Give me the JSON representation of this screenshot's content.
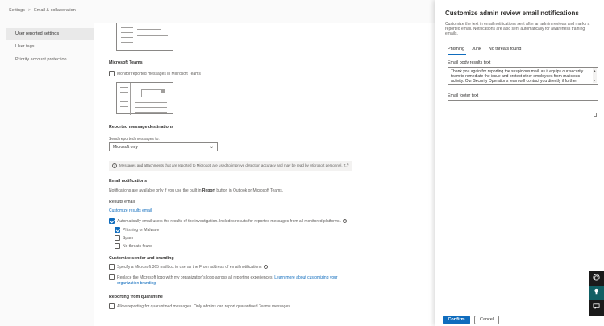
{
  "breadcrumb": {
    "root": "Settings",
    "separator": ">",
    "current": "Email & collaboration"
  },
  "leftnav": {
    "items": [
      {
        "label": "User reported settings"
      },
      {
        "label": "User tags"
      },
      {
        "label": "Priority account protection"
      }
    ]
  },
  "main": {
    "teams_section": {
      "title": "Microsoft Teams",
      "monitor_label": "Monitor reported messages in Microsoft Teams",
      "monitor_checked": false
    },
    "destinations": {
      "title": "Reported message destinations",
      "send_label": "Send reported messages to:",
      "selected": "Microsoft only",
      "info": "Messages and attachments that are reported to Microsoft are used to improve detection accuracy and may be read by Microsoft personnel. T..."
    },
    "email_notifications": {
      "title": "Email notifications",
      "desc_pre": "Notifications are available only if you use the built in ",
      "desc_bold": "Report",
      "desc_post": " button in Outlook or Microsoft Teams.",
      "results_title": "Results email",
      "customize_link": "Customize results email",
      "auto_label": "Automatically email users the results of the investigation. Includes results for reported messages from all monitored platforms.",
      "auto_checked": true,
      "options": [
        {
          "label": "Phishing or Malware",
          "checked": true
        },
        {
          "label": "Spam",
          "checked": false
        },
        {
          "label": "No threats found",
          "checked": false
        }
      ]
    },
    "branding": {
      "title": "Customize sender and branding",
      "mailbox_label": "Specify a Microsoft 365 mailbox to use as the From address of email notifications",
      "logo_label": "Replace the Microsoft logo with my organization's logo across all reporting experiences.",
      "logo_link_1": "Learn more about customizing your",
      "logo_link_2": "organization branding"
    },
    "quarantine": {
      "title": "Reporting from quarantine",
      "allow_label": "Allow reporting for quarantined messages. Only admins can report quarantined Teams messages."
    }
  },
  "panel": {
    "title": "Customize admin review email notifications",
    "desc": "Customize the text in email notifications sent after an admin reviews and marks a reported email. Notifications are also sent automatically for awareness training emails.",
    "tabs": [
      {
        "label": "Phishing",
        "active": true
      },
      {
        "label": "Junk",
        "active": false
      },
      {
        "label": "No threats found",
        "active": false
      }
    ],
    "body_label": "Email body results text",
    "body_text": "Thank you again for reporting the suspicious mail, as it equips our security team to remediate the issue and protect other employees from malicious activity. Our Security Operations team will contact you directly if further",
    "footer_label": "Email footer text",
    "footer_text": "",
    "confirm": "Confirm",
    "cancel": "Cancel"
  },
  "side_actions": {
    "icons": [
      "help-icon",
      "lightbulb-icon",
      "chat-icon"
    ]
  },
  "colors": {
    "accent": "#0f6cbd",
    "teal": "#115f63",
    "dark": "#1a1a1a"
  }
}
